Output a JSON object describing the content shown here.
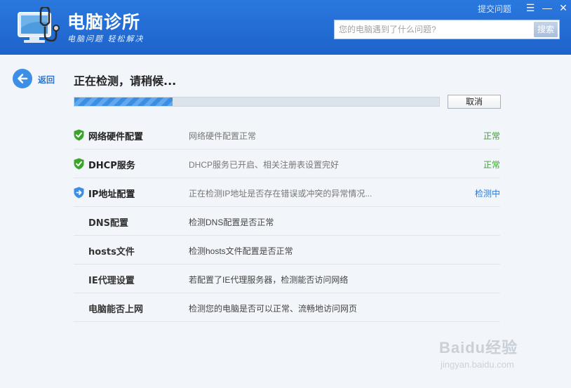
{
  "app": {
    "title": "电脑诊所",
    "slogan": "电脑问题  轻松解决"
  },
  "topbar": {
    "feedback_link": "提交问题",
    "menu_icon": "☰",
    "minimize_icon": "—",
    "close_icon": "✕"
  },
  "search": {
    "placeholder": "您的电脑遇到了什么问题?",
    "button_label": "搜索"
  },
  "back": {
    "label": "返回"
  },
  "scan": {
    "status_title": "正在检测，请稍候...",
    "progress_fraction": 0.27,
    "cancel_label": "取消"
  },
  "items": [
    {
      "name": "网络硬件配置",
      "desc": "网络硬件配置正常",
      "status": "正常",
      "state": "ok"
    },
    {
      "name": "DHCP服务",
      "desc": "DHCP服务已开启、相关注册表设置完好",
      "status": "正常",
      "state": "ok"
    },
    {
      "name": "IP地址配置",
      "desc": "正在检测IP地址是否存在错误或冲突的异常情况...",
      "status": "检测中",
      "state": "checking"
    },
    {
      "name": "DNS配置",
      "desc": "检测DNS配置是否正常",
      "status": "",
      "state": "pending"
    },
    {
      "name": "hosts文件",
      "desc": "检测hosts文件配置是否正常",
      "status": "",
      "state": "pending"
    },
    {
      "name": "IE代理设置",
      "desc": "若配置了IE代理服务器，检测能否访问网络",
      "status": "",
      "state": "pending"
    },
    {
      "name": "电脑能否上网",
      "desc": "检测您的电脑是否可以正常、流畅地访问网页",
      "status": "",
      "state": "pending"
    }
  ],
  "watermark": {
    "text": "Baidu经验",
    "sub": "jingyan.baidu.com"
  },
  "colors": {
    "header": "#1d63cc",
    "ok": "#3aa52a",
    "checking": "#2b77d1",
    "shield_ok": "#3aa52a",
    "shield_checking": "#3d8ee6"
  }
}
